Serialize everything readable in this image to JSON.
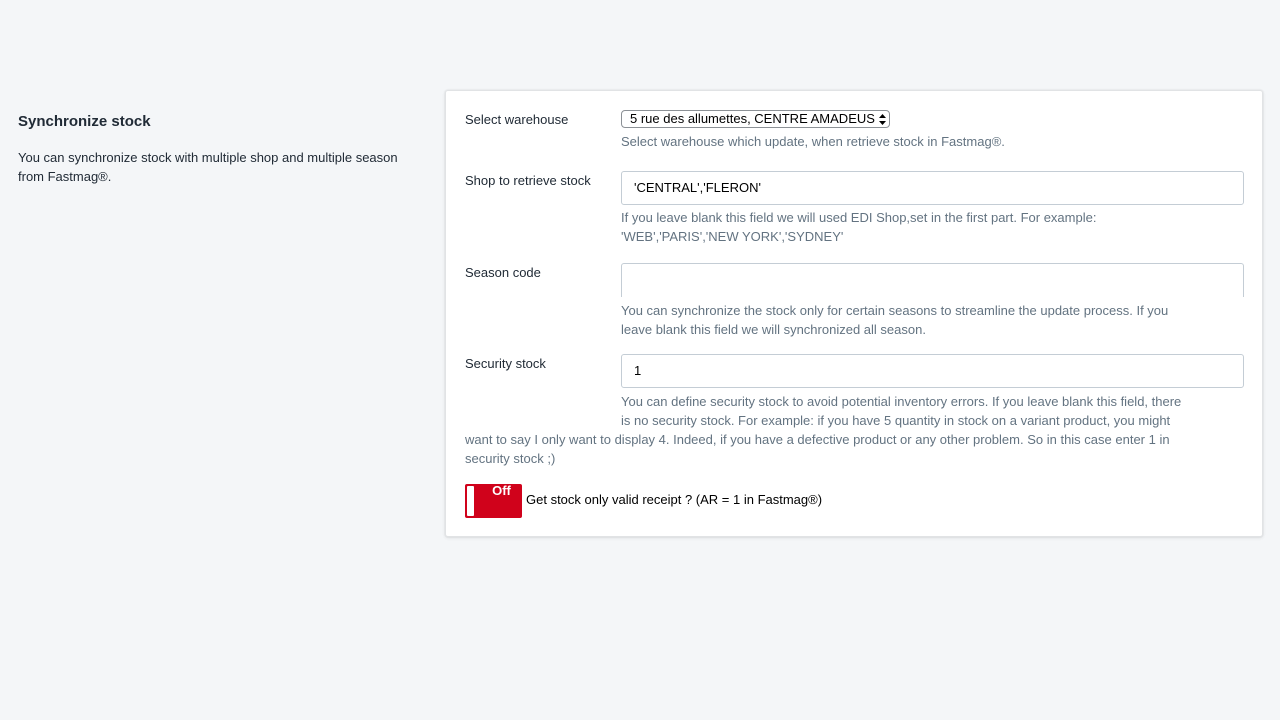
{
  "section": {
    "title": "Synchronize stock",
    "description": "You can synchronize stock with multiple shop and multiple season from Fastmag®."
  },
  "warehouse": {
    "label": "Select warehouse",
    "selected": "5 rue des allumettes, CENTRE AMADEUS",
    "help": "Select warehouse which update, when retrieve stock in Fastmag®."
  },
  "shop": {
    "label": "Shop to retrieve stock",
    "value": "'CENTRAL','FLERON'",
    "help_line1": "If you leave blank this field we will used EDI Shop,set in the first part. For example:",
    "help_line2": "'WEB','PARIS','NEW YORK','SYDNEY'"
  },
  "season": {
    "label": "Season code",
    "value": "",
    "help_line1": "You can synchronize the stock only for certain seasons to streamline the update process. If you",
    "help_line2": "leave blank this field we will synchronized all season."
  },
  "security": {
    "label": "Security stock",
    "value": "1",
    "help_line1": "You can define security stock to avoid potential inventory errors. If you leave blank this field, there",
    "help_line2": "is no security stock. For example: if you have 5 quantity in stock on a variant product, you might",
    "help_line3": "want to say I only want to display 4. Indeed, if you have a defective product or any other problem. So in this case enter 1 in",
    "help_line4": "security stock ;)"
  },
  "receipt_toggle": {
    "state": "Off",
    "label": "Get stock only valid receipt ? (AR = 1 in Fastmag®)",
    "color": "#d0021b"
  }
}
